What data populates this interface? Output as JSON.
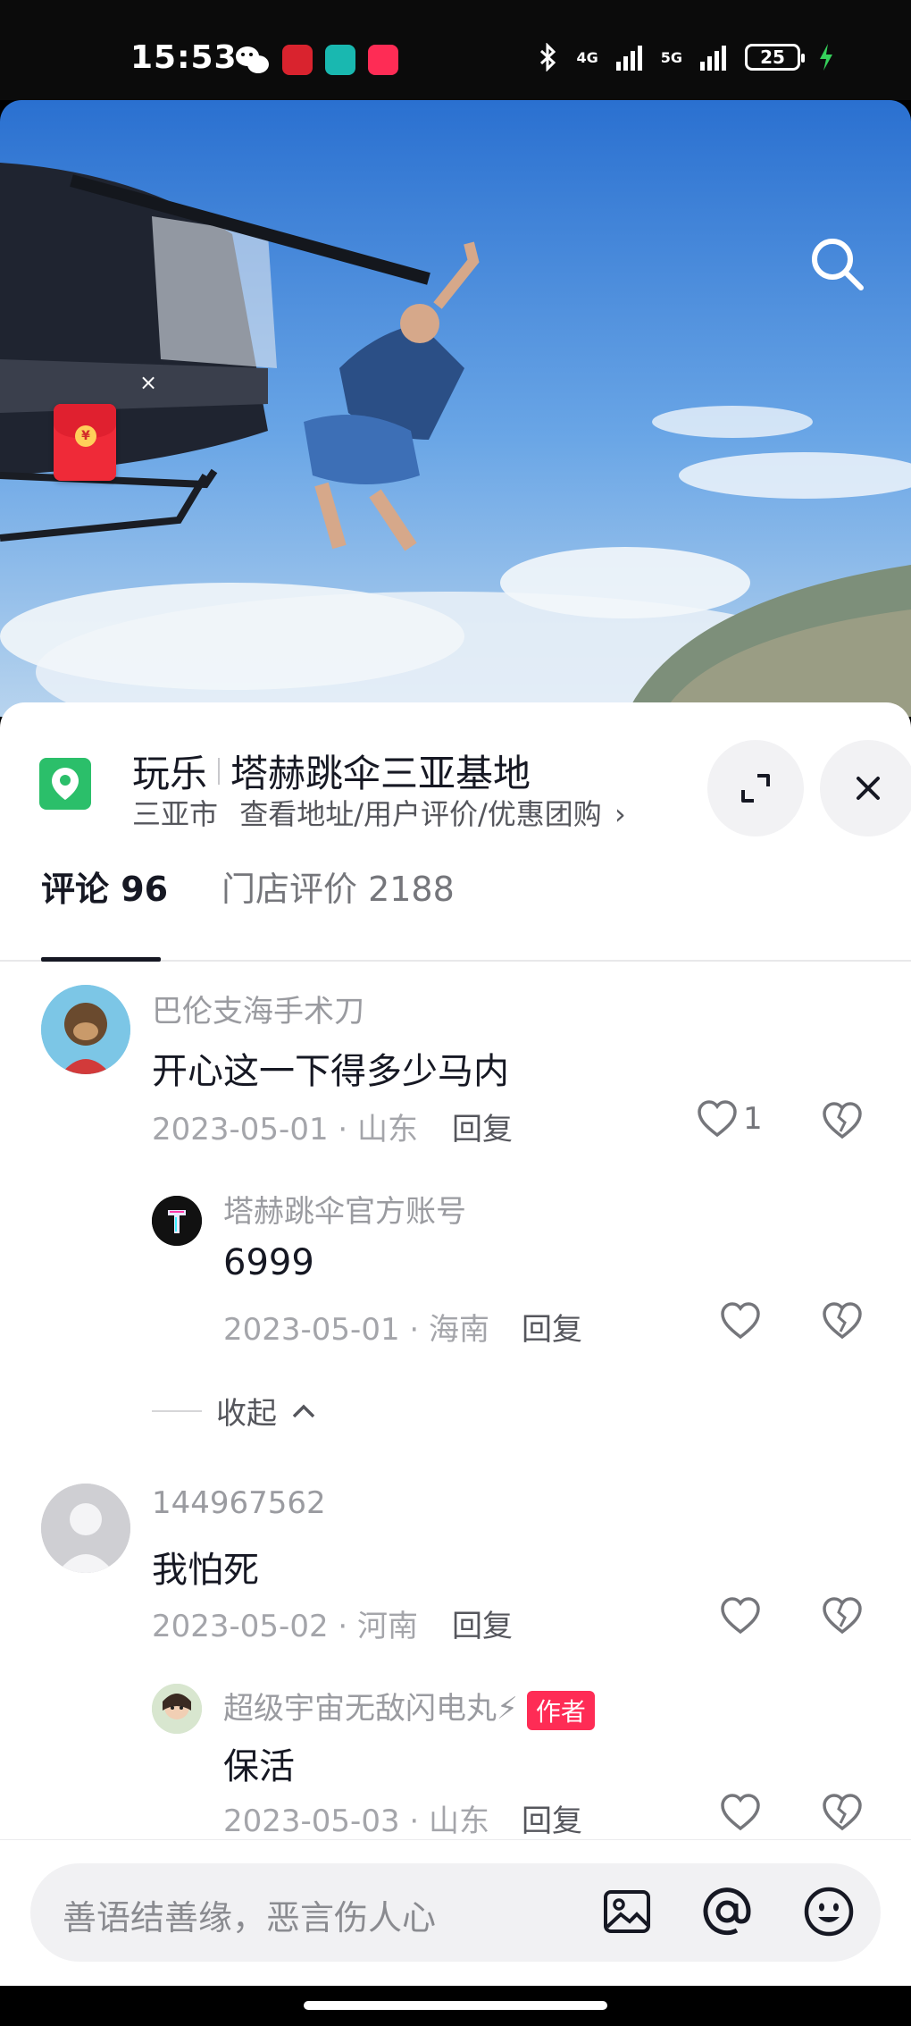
{
  "status_bar": {
    "time": "15:53",
    "battery": "25",
    "network_1": "4G",
    "network_2": "5G"
  },
  "video": {
    "search_icon": "search-icon",
    "red_packet_icon": "red-packet-icon",
    "red_packet_symbol": "¥",
    "red_packet_close": "×"
  },
  "poi": {
    "category": "玩乐",
    "name": "塔赫跳伞三亚基地",
    "city": "三亚市",
    "sub_link": "查看地址/用户评价/优惠团购",
    "chevron": "›",
    "pin_color": "#2bbf6a"
  },
  "tabs": [
    {
      "label": "评论 96"
    },
    {
      "label": "门店评价 2188"
    }
  ],
  "comments": [
    {
      "username": "巴伦支海手术刀",
      "text": "开心这一下得多少马内",
      "date_region": "2023-05-01 · 山东",
      "reply": "回复",
      "likes": "1"
    },
    {
      "username": "塔赫跳伞官方账号",
      "text": "6999",
      "date_region": "2023-05-01 · 海南",
      "reply": "回复"
    },
    {
      "username": "144967562",
      "text": "我怕死",
      "date_region": "2023-05-02 · 河南",
      "reply": "回复"
    },
    {
      "username": "超级宇宙无敌闪电丸⚡",
      "author_tag": "作者",
      "text": "保活",
      "date_region": "2023-05-03 · 山东",
      "reply": "回复"
    }
  ],
  "collapse_label": "收起",
  "input": {
    "placeholder": "善语结善缘，恶言伤人心"
  },
  "colors": {
    "accent": "#fe2c55",
    "text_primary": "#161823",
    "text_secondary": "#9a9ba0"
  }
}
